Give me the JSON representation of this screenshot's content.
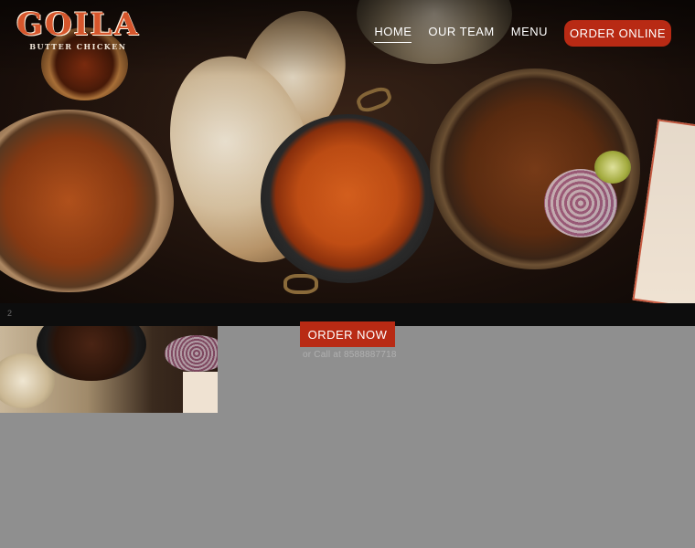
{
  "brand": {
    "name": "GOILA",
    "tagline": "BUTTER CHICKEN"
  },
  "nav": {
    "items": [
      {
        "label": "HOME",
        "active": true
      },
      {
        "label": "OUR TEAM",
        "active": false
      },
      {
        "label": "MENU",
        "active": false
      }
    ],
    "cta_label": "ORDER ONLINE"
  },
  "strip": {
    "indicator": "2"
  },
  "order": {
    "button_label": "ORDER NOW",
    "call_text": "or Call at 8588887718"
  },
  "colors": {
    "accent": "#b82a14",
    "logo": "#d6562c",
    "page_bg": "#8f8f8f"
  }
}
